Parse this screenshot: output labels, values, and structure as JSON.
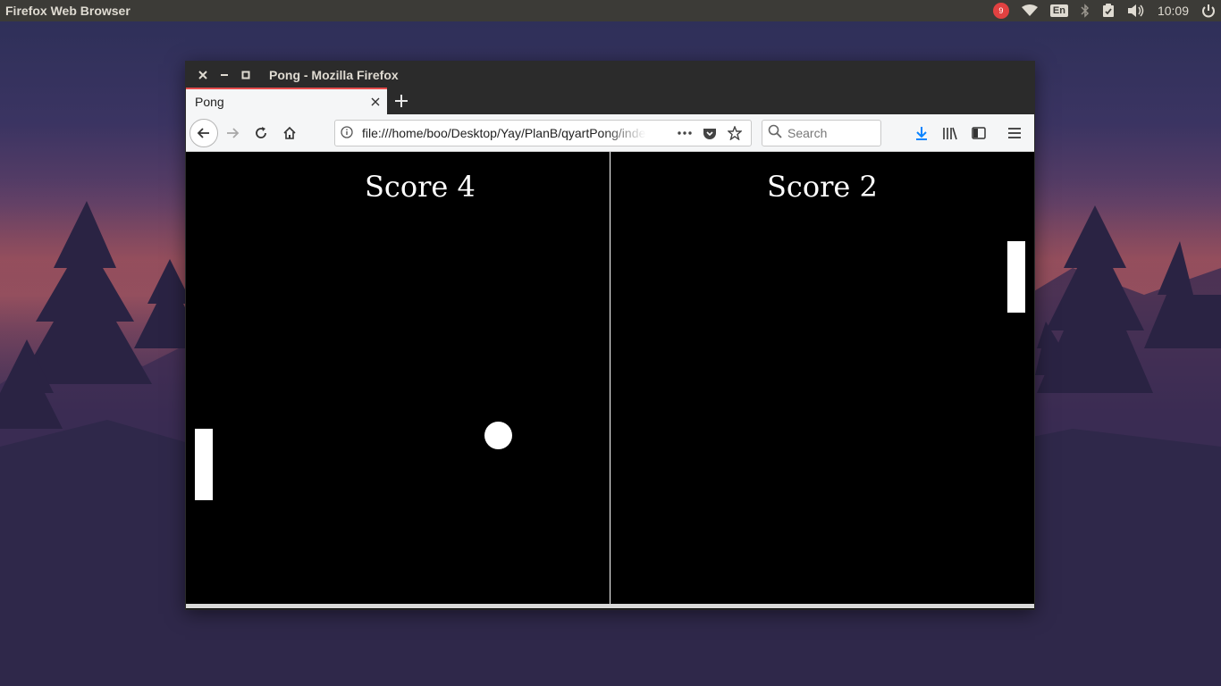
{
  "top_panel": {
    "app_title": "Firefox Web Browser",
    "notification_count": "9",
    "keyboard_layout": "En",
    "clock": "10:09",
    "icons": [
      "notification-badge-icon",
      "wifi-icon",
      "keyboard-layout-icon",
      "bluetooth-icon",
      "clipboard-check-icon",
      "volume-icon",
      "power-settings-icon"
    ]
  },
  "window": {
    "title": "Pong - Mozilla Firefox",
    "controls": [
      "close-icon",
      "minimize-icon",
      "maximize-icon"
    ]
  },
  "tabs": [
    {
      "label": "Pong",
      "active": true
    }
  ],
  "navbar": {
    "url": "file:///home/boo/Desktop/Yay/PlanB/qyartPong/index.html",
    "search_placeholder": "Search"
  },
  "game": {
    "score_left_text": "Score 4",
    "score_right_text": "Score 2"
  },
  "colors": {
    "panel_bg": "#3c3b37",
    "titlebar_bg": "#2b2b2b",
    "tab_accent": "#e54d4d",
    "toolbar_bg": "#f5f6f7",
    "download_blue": "#0a84ff",
    "game_bg": "#000000",
    "game_fg": "#ffffff"
  }
}
